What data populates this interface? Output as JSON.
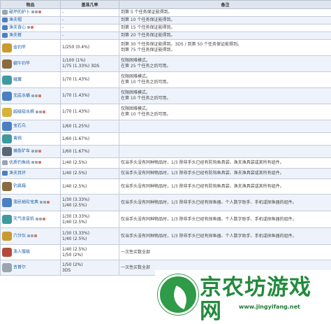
{
  "header": {
    "col_item": "物品",
    "col_rate": "基准几率",
    "col_notes": "备注"
  },
  "rows": [
    {
      "name": "破坏的护卜",
      "rate": "-",
      "notes": "到第 5 个任务保证能得到。",
      "icon": "gray",
      "size": "s",
      "badges": 2
    },
    {
      "name": "渔夫帽",
      "rate": "-",
      "notes": "到第 10 个任务保证能得到。",
      "icon": "blue",
      "size": "s",
      "badges": 0
    },
    {
      "name": "渔夫背心",
      "rate": "-",
      "notes": "到第 15 个任务保证能得到。",
      "icon": "blue",
      "size": "s",
      "badges": 1
    },
    {
      "name": "渔夫裤",
      "rate": "-",
      "notes": "到第 20 个任务保证能得到。",
      "icon": "blue",
      "size": "s",
      "badges": 0
    },
    {
      "name": "金钓竿",
      "rate": "1/250 (0.4%)",
      "notes": "到第 30 个任务保证能得到。3DS / 到第 50 个任务保证能得到。",
      "notes2": "到第 75 个任务保证能得到。",
      "icon": "gold",
      "size": "m",
      "badges": 0
    },
    {
      "name": "蜗牛钓竿",
      "rate": "1/100 (1%)",
      "rate2": "1/75 (1.33%) 3DS",
      "notes": "仅限困难模式。",
      "notes2": "在第 25 个任务之后可用。",
      "icon": "brown",
      "size": "m",
      "badges": 0
    },
    {
      "name": "蛾翼",
      "rate": "1/70 (1.43%)",
      "notes": "仅限困难模式。",
      "notes2": "在第 10 个任务之后可用。",
      "icon": "teal",
      "size": "m",
      "badges": 0
    },
    {
      "name": "无底水桶",
      "rate": "1/70 (1.43%)",
      "notes": "仅限困难模式。",
      "notes2": "在第 10 个任务之后可用。",
      "icon": "blue",
      "size": "m",
      "badges": 2
    },
    {
      "name": "超级吸水棉",
      "rate": "1/70 (1.43%)",
      "notes": "仅限困难模式。",
      "notes2": "在第 10 个任务之后可用。",
      "icon": "yellow",
      "size": "m",
      "badges": 2
    },
    {
      "name": "宝石鸟",
      "rate": "1/60 (1.25%)",
      "notes": "",
      "icon": "blue",
      "size": "m",
      "badges": 0
    },
    {
      "name": "青鸦",
      "rate": "1/60 (1.67%)",
      "notes": "",
      "icon": "teal",
      "size": "m",
      "badges": 0
    },
    {
      "name": "捕鱼矿车",
      "rate": "1/60 (1.67%)",
      "notes": "",
      "icon": "dark",
      "size": "m",
      "badges": 2
    },
    {
      "name": "优质钓鱼线",
      "rate": "1/40 (2.5%)",
      "notes": "仅当手头没有同种物品时，1/3 除非手头已经有防钩鱼具袋、渔夫渔具袋或其所有组件。",
      "icon": "gray",
      "size": "s",
      "badges": 2
    },
    {
      "name": "渔夫耳环",
      "rate": "1/40 (2.5%)",
      "notes": "仅当手头没有同种物品时，1/3 除非手头已经有防钩鱼具袋、渔夫渔具袋或其所有组件。",
      "icon": "blue",
      "size": "s",
      "badges": 0
    },
    {
      "name": "钓具箱",
      "rate": "1/40 (2.5%)",
      "notes": "仅当手头没有同种物品时，1/3 除非手头已经有防钩鱼具袋、渔夫渔具袋或其所有组件。",
      "icon": "brown",
      "size": "m",
      "badges": 0
    },
    {
      "name": "渔民袖珍宝典",
      "rate": "1/30 (3.33%)",
      "rate2": "1/40 (2.5%)",
      "notes": "仅当手头没有同种物品时，1/3 除非手头已经有探鱼器、个人数字助手、手机或探鱼器的组件。",
      "icon": "blue",
      "size": "m",
      "badges": 2
    },
    {
      "name": "天气收音机",
      "rate": "1/30 (3.33%)",
      "rate2": "1/40 (2.5%)",
      "notes": "仅当手头没有同种物品时，1/3 除非手头已经有探鱼器、个人数字助手、手机或探鱼器的组件。",
      "icon": "teal",
      "size": "m",
      "badges": 2
    },
    {
      "name": "六分仪",
      "rate": "1/30 (3.33%)",
      "rate2": "1/40 (2.5%)",
      "notes": "仅当手头没有同种物品时，1/3 除非手头已经有探鱼器、个人数字助手、手机或探鱼器的组件。",
      "icon": "gold",
      "size": "m",
      "badges": 2
    },
    {
      "name": "渔人服装",
      "rate": "1/40 (2.5%)",
      "rate2": "1/50 (2%)",
      "notes": "一次性买数全部",
      "icon": "red",
      "size": "m",
      "badges": 0
    },
    {
      "name": "吉普尔",
      "rate": "1/50 (2%)",
      "rate2": "3DS",
      "notes": "一次性买数全部",
      "icon": "gray",
      "size": "m",
      "badges": 0
    }
  ],
  "icon_colors": {
    "gray": "#9aa5b1",
    "blue": "#4b7fc1",
    "gold": "#c99a2e",
    "brown": "#8b6a3e",
    "teal": "#3f9aa0",
    "yellow": "#d6b33a",
    "dark": "#5a6675",
    "red": "#b34a3c"
  },
  "watermark": {
    "brand": "京农坊游戏网",
    "url": "www.jingyifang.net",
    "color": "#228b3c"
  }
}
